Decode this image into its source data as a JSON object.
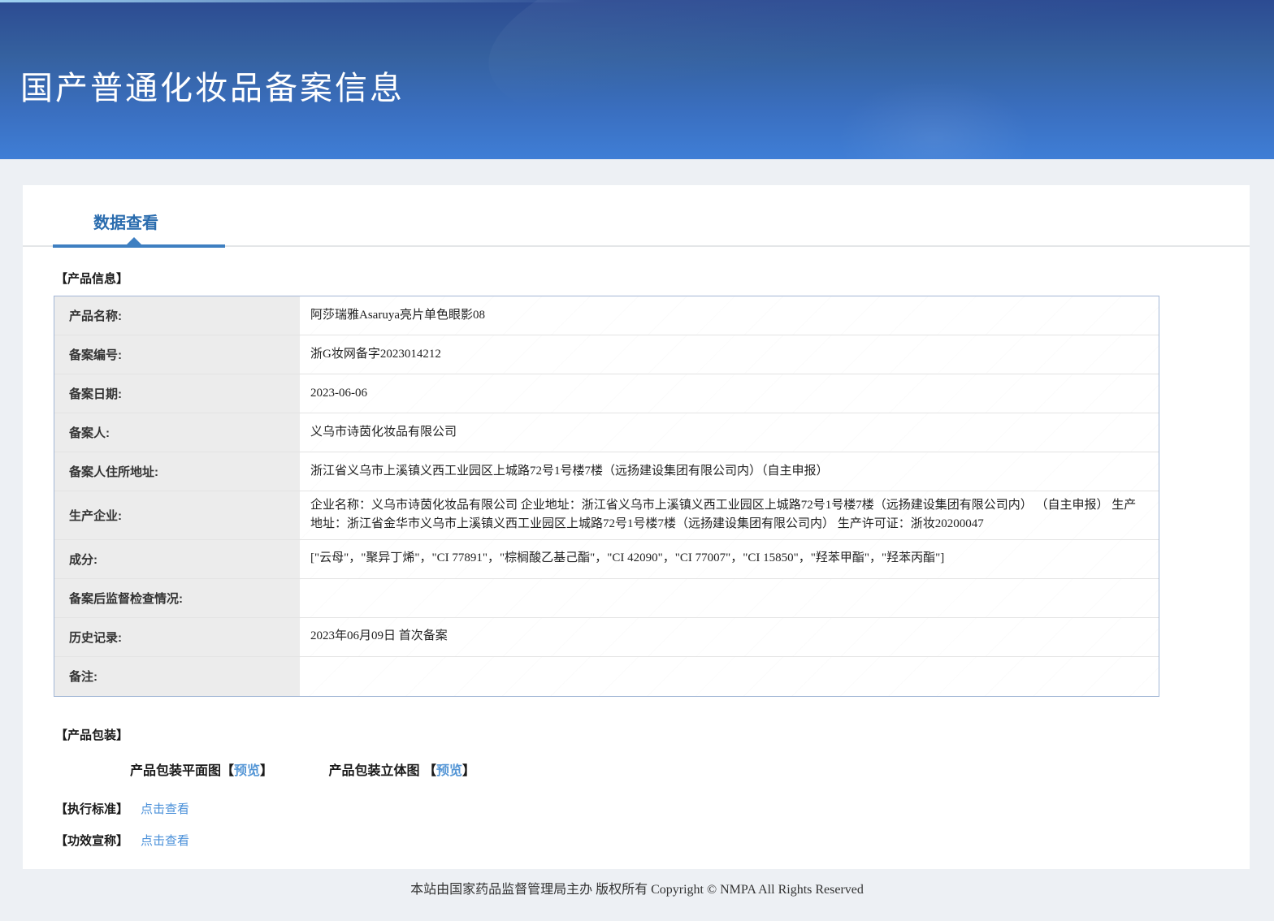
{
  "colors": {
    "header_gradient_top": "#2c4b92",
    "header_gradient_bottom": "#3f7ed6",
    "tab_text": "#2a6cae",
    "tab_accent": "#3e7fc1",
    "link_blue": "#4a90d9",
    "label_cell_bg": "#ececec",
    "table_border": "#a3b7d6"
  },
  "header": {
    "title": "国产普通化妆品备案信息"
  },
  "tab": {
    "label": "数据查看"
  },
  "product_info": {
    "section_title": "【产品信息】",
    "rows": [
      {
        "label": "产品名称:",
        "value": "阿莎瑞雅Asaruya亮片单色眼影08"
      },
      {
        "label": "备案编号:",
        "value": "浙G妆网备字2023014212"
      },
      {
        "label": "备案日期:",
        "value": "2023-06-06"
      },
      {
        "label": "备案人:",
        "value": "义乌市诗茵化妆品有限公司"
      },
      {
        "label": "备案人住所地址:",
        "value": "浙江省义乌市上溪镇义西工业园区上城路72号1号楼7楼（远扬建设集团有限公司内）（自主申报）"
      },
      {
        "label": "生产企业:",
        "value": "企业名称：义乌市诗茵化妆品有限公司 企业地址：浙江省义乌市上溪镇义西工业园区上城路72号1号楼7楼（远扬建设集团有限公司内） （自主申报） 生产地址：浙江省金华市义乌市上溪镇义西工业园区上城路72号1号楼7楼（远扬建设集团有限公司内） 生产许可证：浙妆20200047"
      },
      {
        "label": "成分:",
        "value": "[\"云母\"，\"聚异丁烯\"，\"CI 77891\"，\"棕榈酸乙基己酯\"，\"CI 42090\"，\"CI 77007\"，\"CI 15850\"，\"羟苯甲酯\"，\"羟苯丙酯\"]"
      },
      {
        "label": "备案后监督检查情况:",
        "value": ""
      },
      {
        "label": "历史记录:",
        "value": "2023年06月09日 首次备案"
      },
      {
        "label": "备注:",
        "value": ""
      }
    ]
  },
  "packaging": {
    "section_title": "【产品包装】",
    "flat_label": "产品包装平面图",
    "stereo_label": "产品包装立体图",
    "bracket_open": "【",
    "bracket_close": "】",
    "preview_label": "预览"
  },
  "standards": {
    "title": "【执行标准】",
    "link_label": "点击查看"
  },
  "efficacy": {
    "title": "【功效宣称】",
    "link_label": "点击查看"
  },
  "footer": {
    "text": "本站由国家药品监督管理局主办 版权所有 Copyright © NMPA All Rights Reserved"
  }
}
